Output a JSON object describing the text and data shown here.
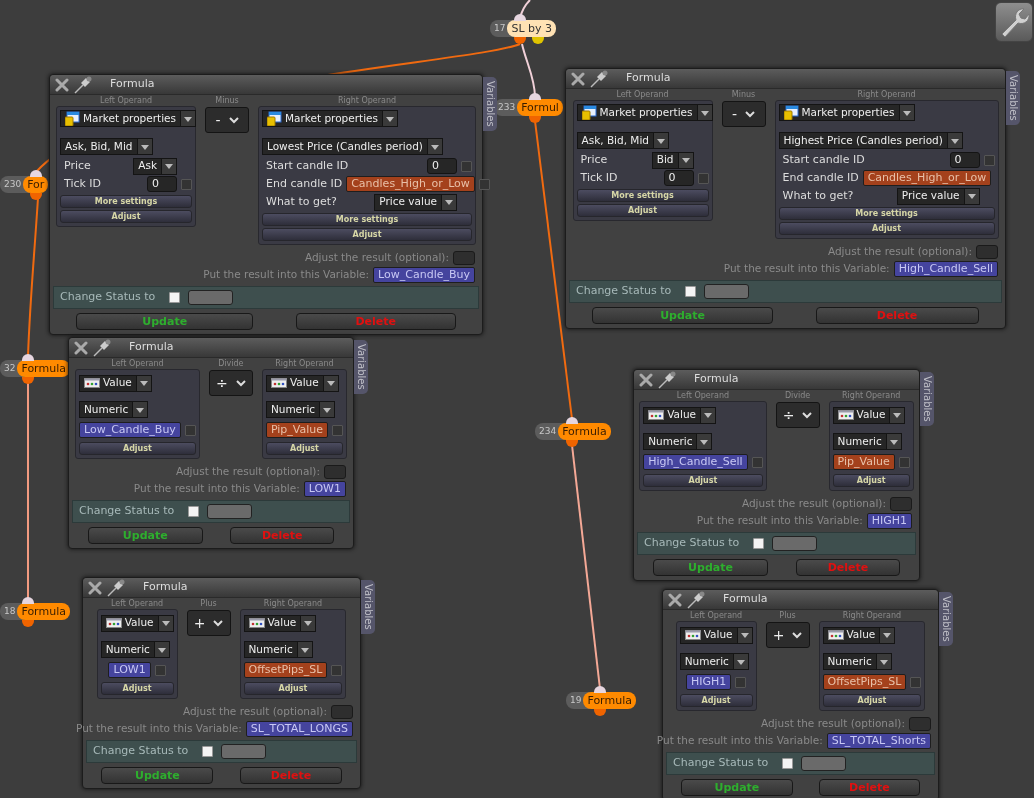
{
  "nodes": [
    {
      "number": "17",
      "label": "SL by 3",
      "kind": "start"
    },
    {
      "number": "230",
      "label": "For",
      "kind": "formula"
    },
    {
      "number": "233",
      "label": "Formul",
      "kind": "formula"
    },
    {
      "number": "32",
      "label": "Formula",
      "kind": "formula"
    },
    {
      "number": "234",
      "label": "Formula",
      "kind": "formula"
    },
    {
      "number": "18",
      "label": "Formula",
      "kind": "formula"
    },
    {
      "number": "19",
      "label": "Formula",
      "kind": "formula"
    }
  ],
  "windows": [
    {
      "title": "Formula",
      "side_tab": "Variables",
      "operator_label": "Minus",
      "operator": "-",
      "left": {
        "header": "Left Operand",
        "kind": "market",
        "type": "Market properties",
        "subtype": "Ask, Bid, Mid",
        "fields": [
          {
            "kind": "select",
            "label": "Price",
            "value": "Ask"
          },
          {
            "kind": "number",
            "label": "Tick ID",
            "value": "0",
            "checked": false
          }
        ],
        "buttons": [
          "More settings",
          "Adjust"
        ]
      },
      "right": {
        "header": "Right Operand",
        "kind": "market",
        "type": "Market properties",
        "subtype": "Lowest Price (Candles period)",
        "fields": [
          {
            "kind": "number",
            "label": "Start candle ID",
            "value": "0",
            "checked": false
          },
          {
            "kind": "variable",
            "label": "End candle ID",
            "value": "Candles_High_or_Low",
            "color": "#a4411c",
            "checked": false
          },
          {
            "kind": "select",
            "label": "What to get?",
            "value": "Price value"
          }
        ],
        "buttons": [
          "More settings",
          "Adjust"
        ]
      },
      "adjust_label": "Adjust the result (optional):",
      "result_label": "Put the result into this Variable:",
      "result_variable": "Low_Candle_Buy",
      "status_label": "Change Status to",
      "status_checked": false,
      "update": "Update",
      "delete": "Delete"
    },
    {
      "title": "Formula",
      "side_tab": "Variables",
      "operator_label": "Minus",
      "operator": "-",
      "left": {
        "header": "Left Operand",
        "kind": "market",
        "type": "Market properties",
        "subtype": "Ask, Bid, Mid",
        "fields": [
          {
            "kind": "select",
            "label": "Price",
            "value": "Bid"
          },
          {
            "kind": "number",
            "label": "Tick ID",
            "value": "0",
            "checked": false
          }
        ],
        "buttons": [
          "More settings",
          "Adjust"
        ]
      },
      "right": {
        "header": "Right Operand",
        "kind": "market",
        "type": "Market properties",
        "subtype": "Highest Price (Candles period)",
        "fields": [
          {
            "kind": "number",
            "label": "Start candle ID",
            "value": "0",
            "checked": false
          },
          {
            "kind": "variable",
            "label": "End candle ID",
            "value": "Candles_High_or_Low",
            "color": "#a4411c"
          },
          {
            "kind": "select",
            "label": "What to get?",
            "value": "Price value"
          }
        ],
        "buttons": [
          "More settings",
          "Adjust"
        ]
      },
      "adjust_label": "Adjust the result (optional):",
      "result_label": "Put the result into this Variable:",
      "result_variable": "High_Candle_Sell",
      "status_label": "Change Status to",
      "status_checked": false,
      "update": "Update",
      "delete": "Delete"
    },
    {
      "title": "Formula",
      "side_tab": "Variables",
      "operator_label": "Divide",
      "operator": "÷",
      "left": {
        "header": "Left Operand",
        "kind": "value",
        "type": "Value",
        "subtype": "Numeric",
        "variable": {
          "text": "Low_Candle_Buy",
          "color": "#45449e",
          "checked": false
        },
        "buttons": [
          "Adjust"
        ]
      },
      "right": {
        "header": "Right Operand",
        "kind": "value",
        "type": "Value",
        "subtype": "Numeric",
        "variable": {
          "text": "Pip_Value",
          "color": "#a4411c",
          "checked": false
        },
        "buttons": [
          "Adjust"
        ]
      },
      "adjust_label": "Adjust the result (optional):",
      "result_label": "Put the result into this Variable:",
      "result_variable": "LOW1",
      "status_label": "Change Status to",
      "status_checked": false,
      "update": "Update",
      "delete": "Delete"
    },
    {
      "title": "Formula",
      "side_tab": "Variables",
      "operator_label": "Divide",
      "operator": "÷",
      "left": {
        "header": "Left Operand",
        "kind": "value",
        "type": "Value",
        "subtype": "Numeric",
        "variable": {
          "text": "High_Candle_Sell",
          "color": "#45449e",
          "checked": false
        },
        "buttons": [
          "Adjust"
        ]
      },
      "right": {
        "header": "Right Operand",
        "kind": "value",
        "type": "Value",
        "subtype": "Numeric",
        "variable": {
          "text": "Pip_Value",
          "color": "#a4411c",
          "checked": false
        },
        "buttons": [
          "Adjust"
        ]
      },
      "adjust_label": "Adjust the result (optional):",
      "result_label": "Put the result into this Variable:",
      "result_variable": "HIGH1",
      "status_label": "Change Status to",
      "status_checked": false,
      "update": "Update",
      "delete": "Delete"
    },
    {
      "title": "Formula",
      "side_tab": "Variables",
      "operator_label": "Plus",
      "operator": "+",
      "left": {
        "header": "Left Operand",
        "kind": "value",
        "type": "Value",
        "subtype": "Numeric",
        "variable": {
          "text": "LOW1",
          "color": "#45449e",
          "checked": false
        },
        "buttons": [
          "Adjust"
        ]
      },
      "right": {
        "header": "Right Operand",
        "kind": "value",
        "type": "Value",
        "subtype": "Numeric",
        "variable": {
          "text": "OffsetPips_SL",
          "color": "#a4411c",
          "checked": false
        },
        "buttons": [
          "Adjust"
        ]
      },
      "adjust_label": "Adjust the result (optional):",
      "result_label": "Put the result into this Variable:",
      "result_variable": "SL_TOTAL_LONGS",
      "status_label": "Change Status to",
      "status_checked": false,
      "update": "Update",
      "delete": "Delete"
    },
    {
      "title": "Formula",
      "side_tab": "Variables",
      "operator_label": "Plus",
      "operator": "+",
      "left": {
        "header": "Left Operand",
        "kind": "value",
        "type": "Value",
        "subtype": "Numeric",
        "variable": {
          "text": "HIGH1",
          "color": "#45449e",
          "checked": false
        },
        "buttons": [
          "Adjust"
        ]
      },
      "right": {
        "header": "Right Operand",
        "kind": "value",
        "type": "Value",
        "subtype": "Numeric",
        "variable": {
          "text": "OffsetPips_SL",
          "color": "#a4411c",
          "checked": false
        },
        "buttons": [
          "Adjust"
        ]
      },
      "adjust_label": "Adjust the result (optional):",
      "result_label": "Put the result into this Variable:",
      "result_variable": "SL_TOTAL_Shorts",
      "status_label": "Change Status to",
      "status_checked": false,
      "update": "Update",
      "delete": "Delete"
    }
  ]
}
